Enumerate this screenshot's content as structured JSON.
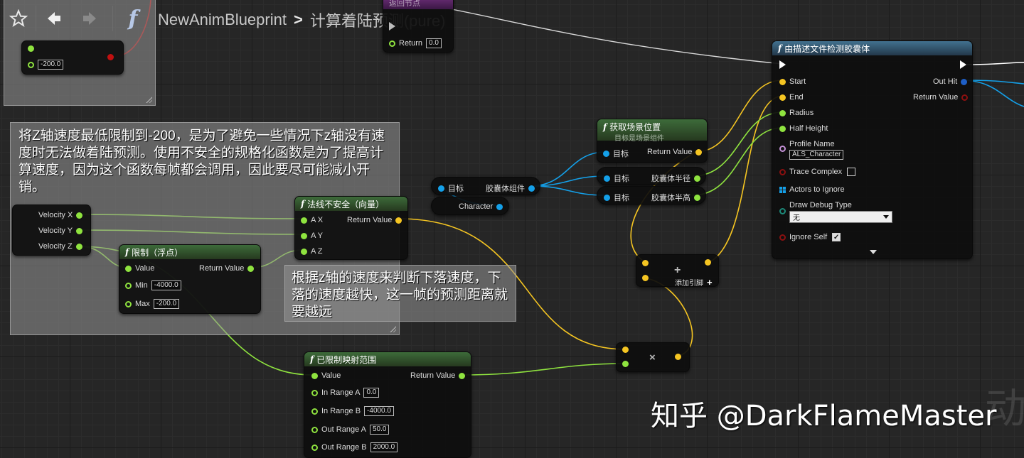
{
  "colors": {
    "float_pin": "#8fe33f",
    "vector_pin": "#f5c522",
    "object_pin": "#14a0e9",
    "bool_pin": "#8c1010",
    "name_pin": "#c592d8",
    "struct_pin": "#1c8a7a"
  },
  "toolbar": {
    "breadcrumb_root": "NewAnimBlueprint",
    "breadcrumb_separator": ">",
    "breadcrumb_current": "计算着陆预测(pure)",
    "icons": [
      "star-icon",
      "back-arrow-icon",
      "forward-arrow-icon",
      "function-icon"
    ]
  },
  "return_node": {
    "title": "返回节点",
    "pin_label": "Return",
    "pin_value": "0.0"
  },
  "const_node": {
    "value": "-200.0"
  },
  "comment_top": {
    "text": "将Z轴速度最低限制到-200，是为了避免一些情况下z轴没有速度时无法做着陆预测。使用不安全的规格化函数是为了提高计算速度，因为这个函数每帧都会调用，因此要尽可能减小开销。"
  },
  "comment_mid": {
    "text": "根据z轴的速度来判断下落速度，下落的速度越快，这一帧的预测距离就要越远"
  },
  "break_node": {
    "pins": [
      "Velocity X",
      "Velocity Y",
      "Velocity Z"
    ]
  },
  "clamp_node": {
    "title": "限制（浮点）",
    "value_label": "Value",
    "return_label": "Return Value",
    "min_label": "Min",
    "min_value": "-4000.0",
    "max_label": "Max",
    "max_value": "-200.0"
  },
  "normal_node": {
    "title": "法线不安全（向量）",
    "pins": [
      "A X",
      "A Y",
      "A Z"
    ],
    "return_label": "Return Value"
  },
  "target_node": {
    "target_label": "目标",
    "component_label": "胶囊体组件"
  },
  "character_node": {
    "label": "Character"
  },
  "worldloc_node": {
    "title": "获取场景位置",
    "subtitle": "目标是场景组件",
    "target_label": "目标",
    "return_label": "Return Value"
  },
  "radius_node": {
    "target_label": "目标",
    "label": "胶囊体半径"
  },
  "halfheight_node": {
    "target_label": "目标",
    "label": "胶囊体半高"
  },
  "add_node": {
    "symbol": "+",
    "add_pin_label": "添加引脚"
  },
  "multiply_node": {
    "symbol": "×"
  },
  "range_node": {
    "title": "已限制映射范围",
    "value_label": "Value",
    "return_label": "Return Value",
    "rows": [
      {
        "label": "In Range A",
        "value": "0.0"
      },
      {
        "label": "In Range B",
        "value": "-4000.0"
      },
      {
        "label": "Out Range A",
        "value": "50.0"
      },
      {
        "label": "Out Range B",
        "value": "2000.0"
      }
    ]
  },
  "capsule_node": {
    "title": "由描述文件检测胶囊体",
    "inputs": [
      "Start",
      "End",
      "Radius",
      "Half Height"
    ],
    "profile_label": "Profile Name",
    "profile_value": "ALS_Character",
    "trace_complex_label": "Trace Complex",
    "actors_ignore_label": "Actors to Ignore",
    "draw_debug_label": "Draw Debug Type",
    "draw_debug_value": "无",
    "ignore_self_label": "Ignore Self",
    "out_hit_label": "Out Hit",
    "return_label": "Return Value"
  },
  "watermark": {
    "text": "知乎 @DarkFlameMaster",
    "corner_glyph": "动"
  }
}
